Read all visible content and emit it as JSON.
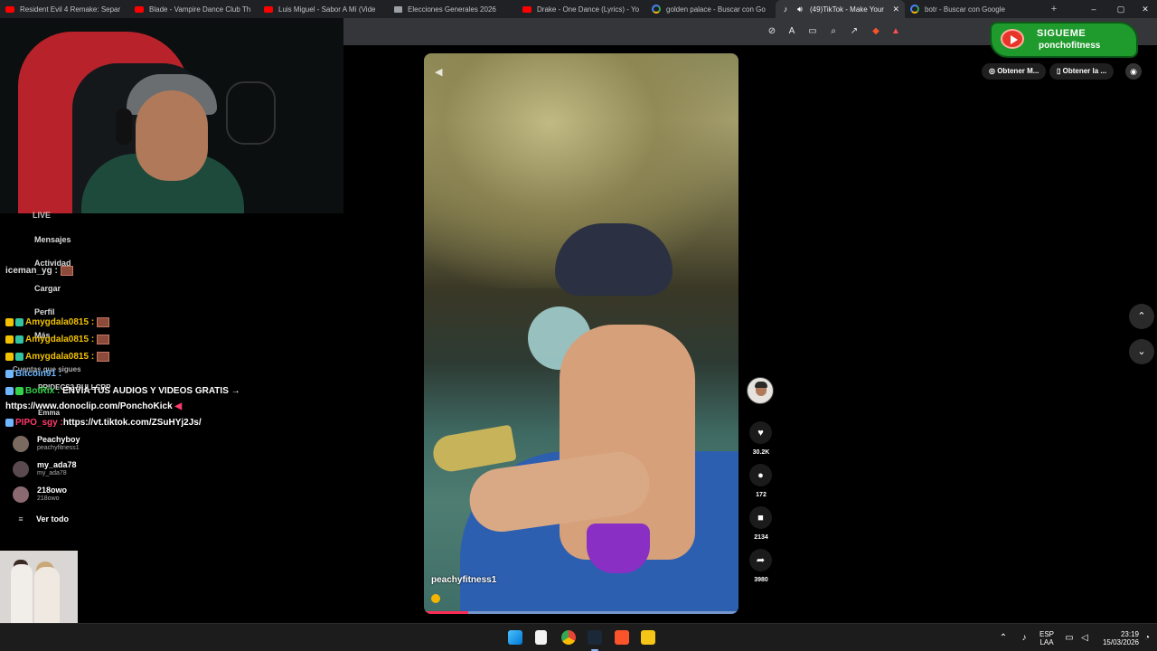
{
  "browser": {
    "tabs": [
      {
        "label": "Resident Evil 4 Remake: Separ",
        "icon": "youtube-icon"
      },
      {
        "label": "Blade - Vampire Dance Club Th",
        "icon": "youtube-icon"
      },
      {
        "label": "Luis Miguel - Sabor A Mí (Vide",
        "icon": "youtube-icon"
      },
      {
        "label": "Elecciones Generales 2026",
        "icon": "document-icon"
      },
      {
        "label": "Drake - One Dance (Lyrics) - Yo",
        "icon": "youtube-icon"
      },
      {
        "label": "golden palace - Buscar con Go",
        "icon": "google-icon"
      },
      {
        "label": "(49)TikTok - Make Your",
        "icon": "tiktok-icon",
        "active": true
      },
      {
        "label": "botr - Buscar con Google",
        "icon": "google-icon"
      }
    ],
    "new_tab": "+",
    "window_controls": {
      "minimize": "–",
      "maximize": "▢",
      "close": "✕"
    }
  },
  "stream_overlay": {
    "banner": {
      "line1": "SIGUEME",
      "line2": "ponchofitness"
    }
  },
  "chat": {
    "lines": [
      {
        "user": "Amygdala0815 :",
        "color": "#f2c200"
      },
      {
        "user": "Amygdala0815 :",
        "color": "#f2c200"
      },
      {
        "user": "Amygdala0815 :",
        "color": "#f2c200"
      },
      {
        "user": "Bitcoin91 :",
        "color": "#6fb7ff"
      },
      {
        "user": "BotRix :",
        "color": "#35d14a",
        "message": "ENVIA TUS AUDIOS Y VIDEOS GRATIS →"
      },
      {
        "message": "https://www.donoclip.com/PonchoKick"
      },
      {
        "user": "PIPO_sgy :",
        "color": "#ff3b6b",
        "message": "https://vt.tiktok.com/ZSuHYj2Js/"
      }
    ],
    "faded_names": [
      "iceman_yg :",
      "LIVE",
      "Mensajes",
      "Actividad",
      "Cargar",
      "Perfil",
      "Más",
      "Cuentas que sigues",
      "PRIDECS2 BULLCRP",
      "Emma"
    ]
  },
  "tiktok_sidebar": {
    "following": [
      {
        "name": "Peachyboy",
        "handle": "peachyfitness1"
      },
      {
        "name": "my_ada78",
        "handle": "my_ada78"
      },
      {
        "name": "218owo",
        "handle": "218owo"
      }
    ],
    "see_all": "Ver todo"
  },
  "video": {
    "author": "peachyfitness1",
    "progress": 0.14,
    "likes": "30.2K",
    "comments": "172",
    "saves": "2134",
    "shares": "3980"
  },
  "top_right": {
    "pill1": "Obtener M...",
    "pill2": "Obtener la ..."
  },
  "taskbar": {
    "lang_line1": "ESP",
    "lang_line2": "LAA",
    "time": "23:19",
    "date": "15/03/2026"
  }
}
